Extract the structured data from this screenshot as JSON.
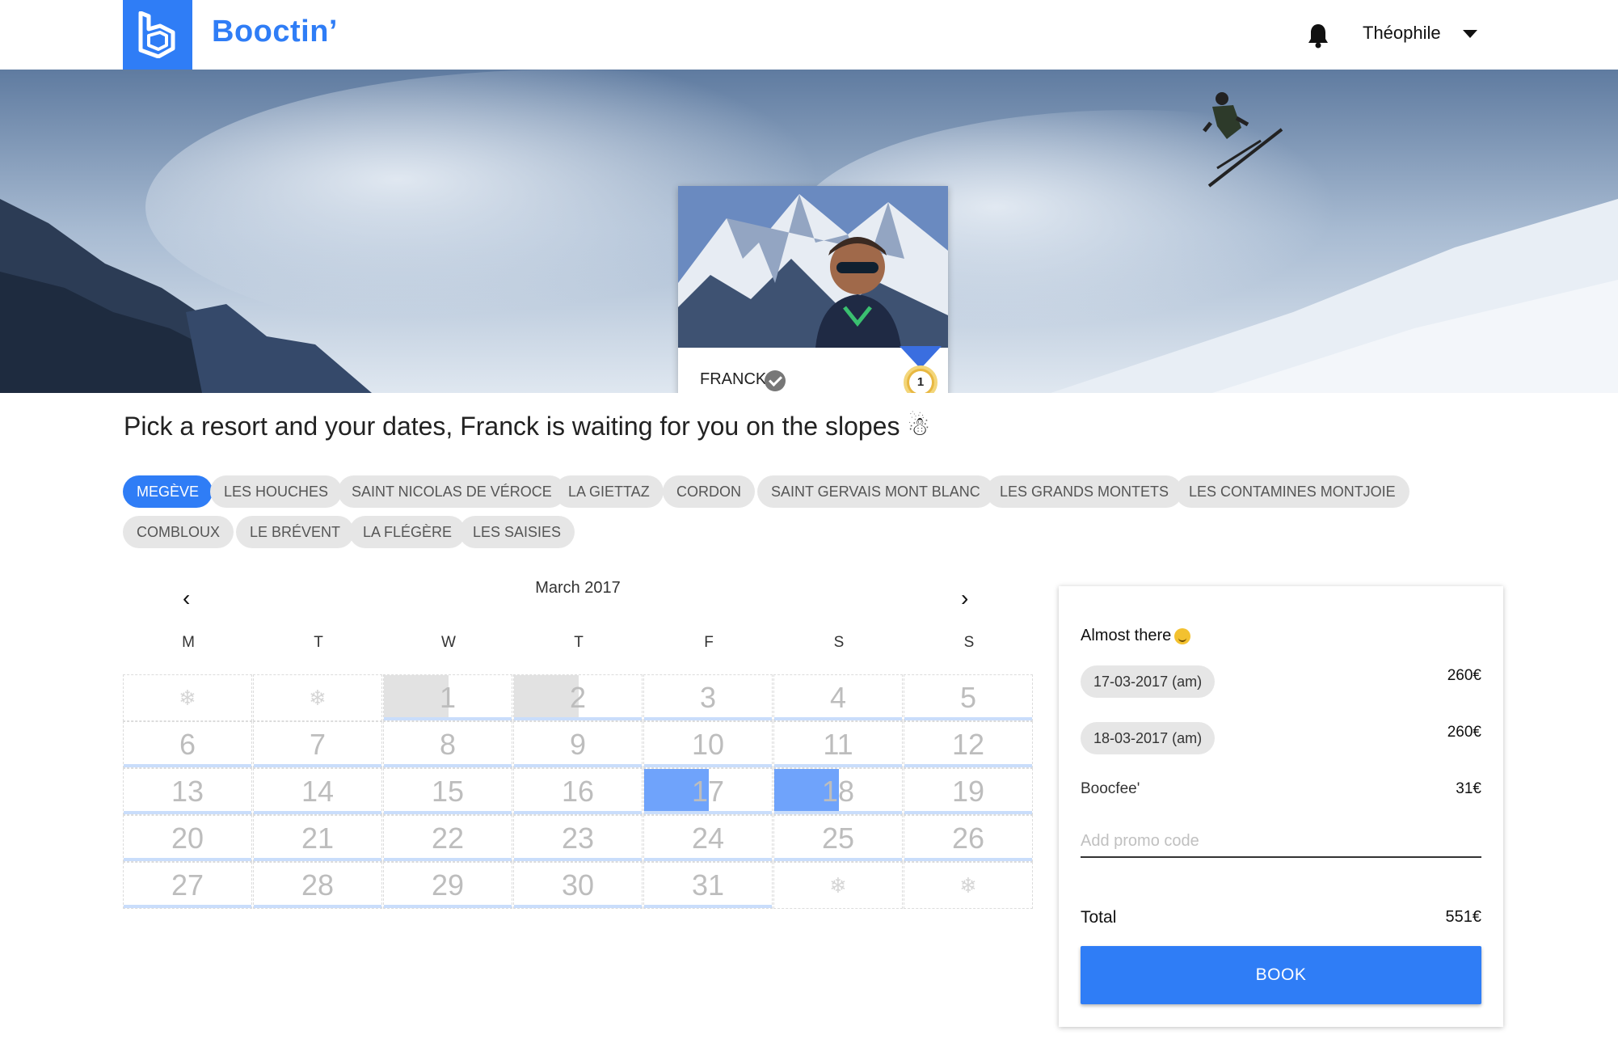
{
  "app": {
    "name": "Booctin’",
    "accent": "#2f7df6"
  },
  "header": {
    "user_name": "Théophile"
  },
  "profile": {
    "name": "FRANCK",
    "rank": "1"
  },
  "headline": "Pick a resort and your dates, Franck is waiting for you on the slopes ☃",
  "resorts": [
    "MEGÈVE",
    "LES HOUCHES",
    "SAINT NICOLAS DE VÉROCE",
    "LA GIETTAZ",
    "CORDON",
    "SAINT GERVAIS MONT BLANC",
    "LES GRANDS MONTETS",
    "LES CONTAMINES MONTJOIE",
    "COMBLOUX",
    "LE BRÉVENT",
    "LA FLÉGÈRE",
    "LES SAISIES"
  ],
  "selected_resort": "MEGÈVE",
  "calendar": {
    "month": "March 2017",
    "prev": "‹",
    "next": "›",
    "weekdays": [
      "M",
      "T",
      "W",
      "T",
      "F",
      "S",
      "S"
    ],
    "unavailable_symbol": "❄",
    "days": [
      [
        "❄",
        "❄",
        "1",
        "2",
        "3",
        "4",
        "5"
      ],
      [
        "6",
        "7",
        "8",
        "9",
        "10",
        "11",
        "12"
      ],
      [
        "13",
        "14",
        "15",
        "16",
        "17",
        "18",
        "19"
      ],
      [
        "20",
        "21",
        "22",
        "23",
        "24",
        "25",
        "26"
      ],
      [
        "27",
        "28",
        "29",
        "30",
        "31",
        "❄",
        "❄"
      ]
    ],
    "booked_half_days": [
      "1",
      "2"
    ],
    "selected_half_days": [
      "17",
      "18"
    ]
  },
  "booking": {
    "title": "Almost there",
    "items": [
      {
        "label": "17-03-2017 (am)",
        "price": "260€"
      },
      {
        "label": "18-03-2017 (am)",
        "price": "260€"
      }
    ],
    "fee_label": "Boocfee'",
    "fee_price": "31€",
    "promo_placeholder": "Add promo code",
    "total_label": "Total",
    "total_price": "551€",
    "book_label": "BOOK"
  }
}
